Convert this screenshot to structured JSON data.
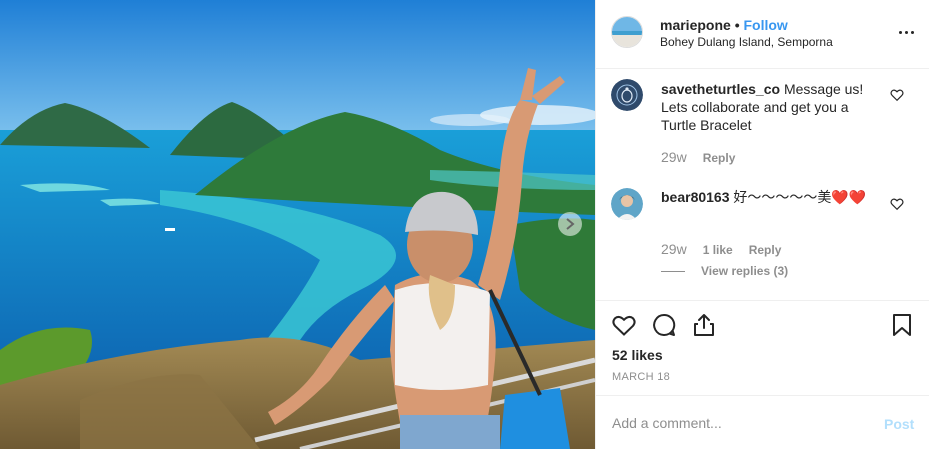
{
  "post": {
    "username": "mariepone",
    "separator": "•",
    "follow_label": "Follow",
    "location": "Bohey Dulang Island, Semporna",
    "more_icon": "more-options-icon"
  },
  "comments": [
    {
      "username": "savetheturtles_co",
      "text": "Message us! Lets collaborate and get you a Turtle Bracelet",
      "time": "29w",
      "likes_label": "",
      "reply_label": "Reply"
    },
    {
      "username": "bear80163",
      "text": "好～～～～～美❤️❤️",
      "time": "29w",
      "likes_label": "1 like",
      "reply_label": "Reply",
      "view_replies": "View replies (3)"
    }
  ],
  "actions": {
    "icons": [
      "heart-icon",
      "comment-icon",
      "share-icon",
      "bookmark-icon"
    ],
    "likes": "52 likes",
    "date": "MARCH 18"
  },
  "add_comment": {
    "placeholder": "Add a comment...",
    "post_label": "Post"
  },
  "colors": {
    "link_blue": "#3897f0",
    "post_disabled": "#b2dffc",
    "text_primary": "#262626",
    "text_secondary": "#8e8e8e"
  }
}
